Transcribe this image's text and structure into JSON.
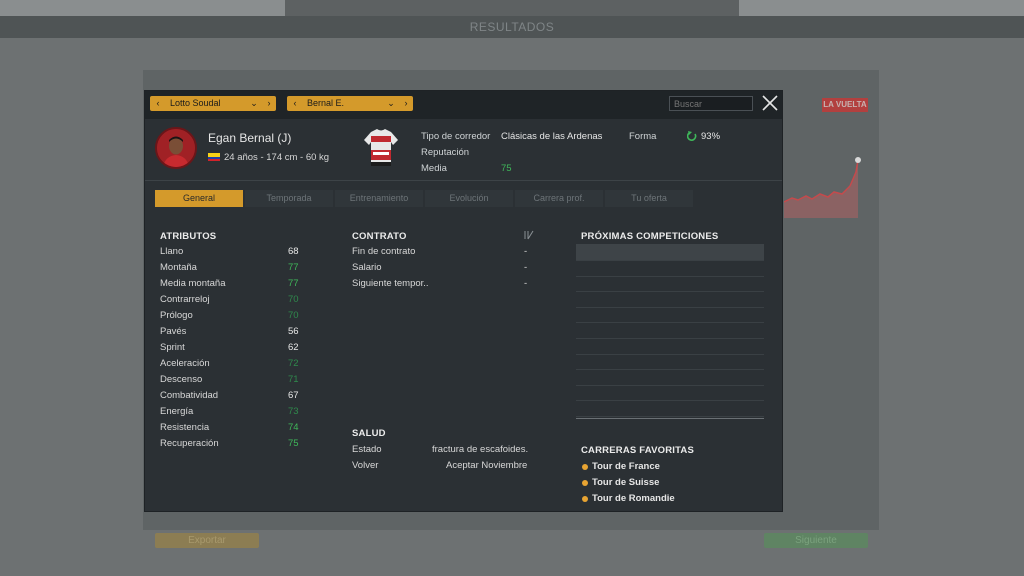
{
  "background": {
    "header_title": "RESULTADOS",
    "race_logo": "LA VUELTA",
    "left_button": "Exportar",
    "right_button": "Siguiente"
  },
  "topbar": {
    "team_selector": "Lotto Soudal",
    "rider_selector": "Bernal E.",
    "search_placeholder": "Buscar",
    "close_icon": "close-icon"
  },
  "rider": {
    "name": "Egan Bernal (J)",
    "bio": "24 años - 174 cm - 60 kg",
    "country_flag": "colombia-flag-icon",
    "type_label": "Tipo de corredor",
    "type_value": "Clásicas de las Ardenas",
    "reputation_label": "Reputación",
    "average_label": "Media",
    "average_value": "75",
    "form_label": "Forma",
    "form_value": "93%"
  },
  "tabs": [
    {
      "label": "General",
      "active": true
    },
    {
      "label": "Temporada",
      "active": false
    },
    {
      "label": "Entrenamiento",
      "active": false
    },
    {
      "label": "Evolución",
      "active": false
    },
    {
      "label": "Carrera prof.",
      "active": false
    },
    {
      "label": "Tu oferta",
      "active": false
    }
  ],
  "attributes": {
    "title": "ATRIBUTOS",
    "items": [
      {
        "name": "Llano",
        "value": "68",
        "tone": "white"
      },
      {
        "name": "Montaña",
        "value": "77",
        "tone": "green"
      },
      {
        "name": "Media montaña",
        "value": "77",
        "tone": "green"
      },
      {
        "name": "Contrarreloj",
        "value": "70",
        "tone": "darkgreen"
      },
      {
        "name": "Prólogo",
        "value": "70",
        "tone": "darkgreen"
      },
      {
        "name": "Pavés",
        "value": "56",
        "tone": "white"
      },
      {
        "name": "Sprint",
        "value": "62",
        "tone": "white"
      },
      {
        "name": "Aceleración",
        "value": "72",
        "tone": "darkgreen"
      },
      {
        "name": "Descenso",
        "value": "71",
        "tone": "darkgreen"
      },
      {
        "name": "Combatividad",
        "value": "67",
        "tone": "white"
      },
      {
        "name": "Energía",
        "value": "73",
        "tone": "darkgreen"
      },
      {
        "name": "Resistencia",
        "value": "74",
        "tone": "green"
      },
      {
        "name": "Recuperación",
        "value": "75",
        "tone": "green"
      }
    ]
  },
  "contract": {
    "title": "CONTRATO",
    "rows": [
      {
        "label": "Fin de contrato",
        "value": "-"
      },
      {
        "label": "Salario",
        "value": "-"
      },
      {
        "label": "Siguiente tempor..",
        "value": "-"
      }
    ]
  },
  "health": {
    "title": "SALUD",
    "status_label": "Estado",
    "status_value": "fractura de escafoides.",
    "return_label": "Volver",
    "return_value": "Aceptar Noviembre"
  },
  "competitions": {
    "title": "PRÓXIMAS COMPETICIONES"
  },
  "favorites": {
    "title": "CARRERAS FAVORITAS",
    "items": [
      "Tour de France",
      "Tour de Suisse",
      "Tour de Romandie"
    ]
  },
  "colors": {
    "accent": "#d49a2b",
    "green": "#3fb85a",
    "panel": "#2b3034"
  }
}
